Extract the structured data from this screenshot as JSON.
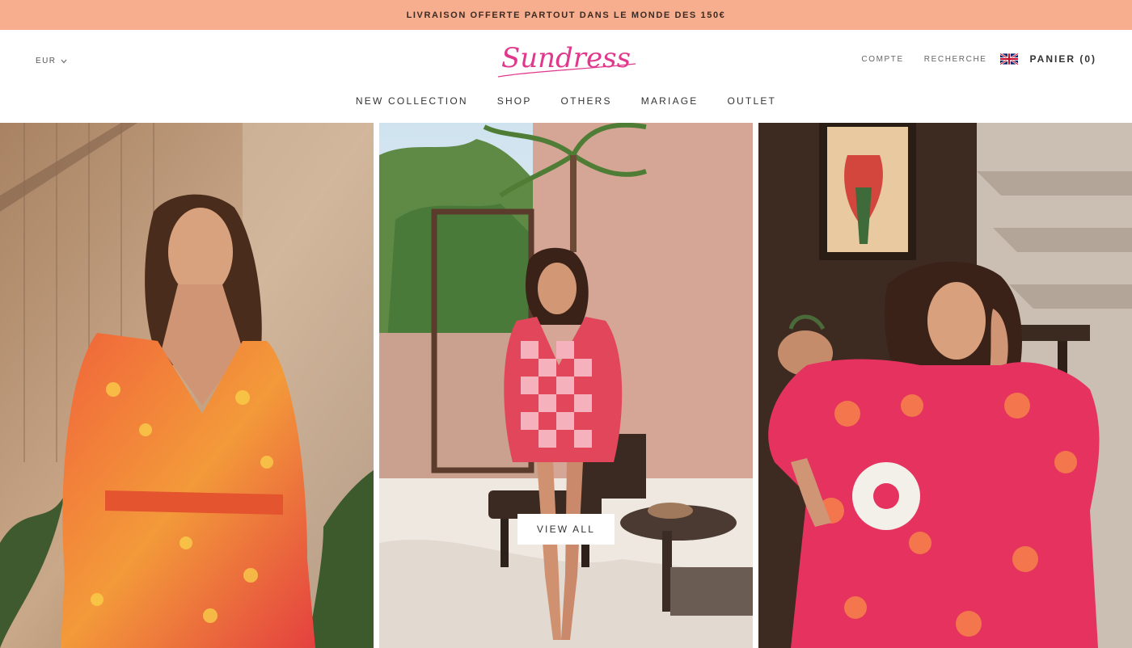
{
  "announcement": {
    "text": "LIVRAISON OFFERTE PARTOUT DANS LE MONDE DES 150€"
  },
  "header": {
    "currency": "EUR",
    "logo_text": "Sundress",
    "account_label": "COMPTE",
    "search_label": "RECHERCHE",
    "cart_label": "PANIER (0)",
    "language_flag": "uk-flag-icon"
  },
  "main_nav": {
    "items": [
      "NEW COLLECTION",
      "SHOP",
      "OTHERS",
      "MARIAGE",
      "OUTLET"
    ]
  },
  "hero": {
    "cta_label": "VIEW ALL"
  },
  "colors": {
    "announcement_bg": "#f7ae8f",
    "brand_pink": "#e0388c",
    "text_dark": "#333333"
  }
}
